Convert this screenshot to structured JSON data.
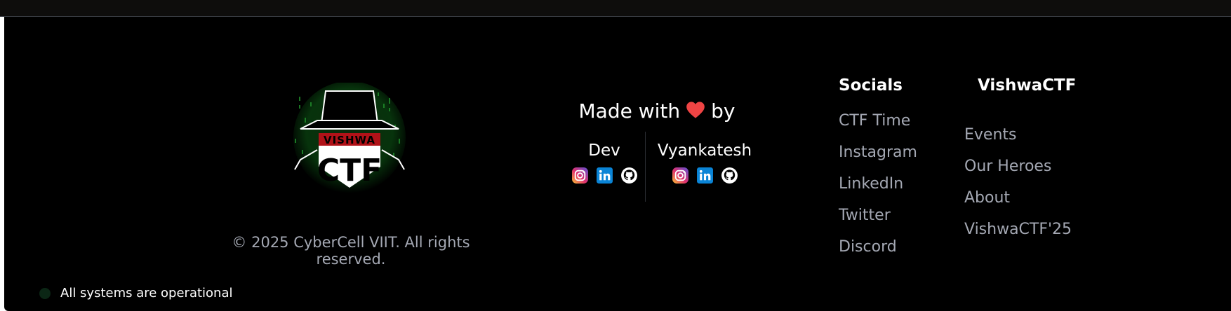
{
  "logo": {
    "alt_text": "VISHWA CTF"
  },
  "copyright": "© 2025 CyberCell VIIT. All rights reserved.",
  "status": {
    "text": "All systems are operational"
  },
  "credits": {
    "made_with_prefix": "Made with",
    "made_with_suffix": "by",
    "heart_icon": "heart-icon",
    "heart_color": "#ef4444",
    "devs": [
      {
        "name": "Dev",
        "icons": [
          "instagram-icon",
          "linkedin-icon",
          "github-icon"
        ]
      },
      {
        "name": "Vyankatesh",
        "icons": [
          "instagram-icon",
          "linkedin-icon",
          "github-icon"
        ]
      }
    ]
  },
  "socials": {
    "title": "Socials",
    "links": [
      "CTF Time",
      "Instagram",
      "LinkedIn",
      "Twitter",
      "Discord"
    ]
  },
  "vishwactf": {
    "title": "VishwaCTF",
    "links": [
      "Events",
      "Our Heroes",
      "About",
      "VishwaCTF'25"
    ]
  },
  "colors": {
    "background": "#000000",
    "link": "#a4a8b3",
    "logo_red": "#b01218",
    "matrix_green": "#1f8a2a"
  }
}
